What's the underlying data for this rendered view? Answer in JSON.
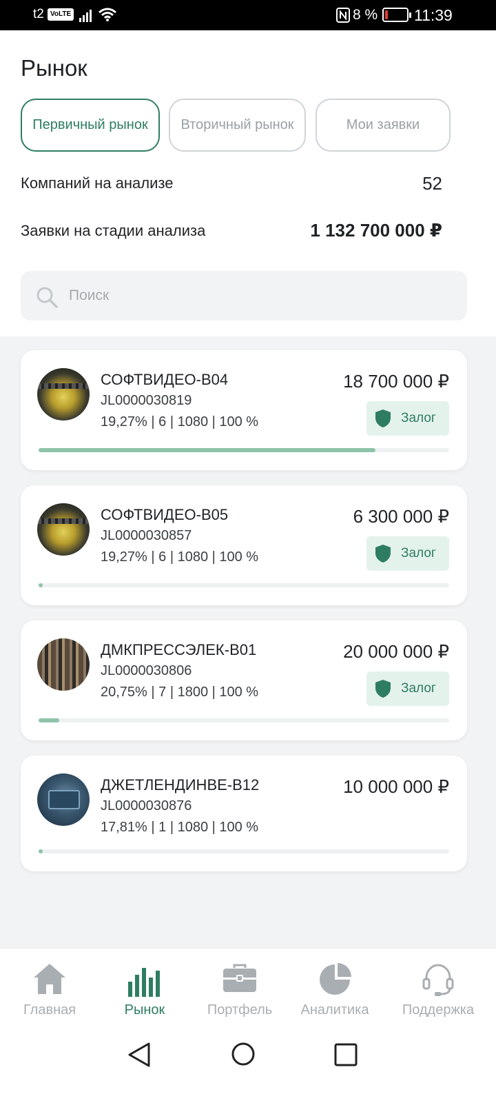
{
  "status_bar": {
    "carrier": "t2",
    "volte": "VoLTE",
    "battery_pct": "8 %",
    "time": "11:39"
  },
  "header": {
    "title": "Рынок"
  },
  "tabs": [
    {
      "label": "Первичный рынок",
      "active": true
    },
    {
      "label": "Вторичный рынок",
      "active": false
    },
    {
      "label": "Мои заявки",
      "active": false
    }
  ],
  "stats": {
    "companies_label": "Компаний на анализе",
    "companies_value": "52",
    "requests_label": "Заявки на стадии анализа",
    "requests_value": "1 132 700 000 ₽"
  },
  "search": {
    "placeholder": "Поиск",
    "value": ""
  },
  "cards": [
    {
      "name": "СОФТВИДЕО-В04",
      "code": "JL0000030819",
      "params": "19,27% | 6 | 1080 | 100 %",
      "amount": "18 700 000 ₽",
      "badge": "Залог",
      "progress": 0.82
    },
    {
      "name": "СОФТВИДЕО-В05",
      "code": "JL0000030857",
      "params": "19,27% | 6 | 1080 | 100 %",
      "amount": "6 300 000 ₽",
      "badge": "Залог",
      "progress": 0.01
    },
    {
      "name": "ДМКПРЕССЭЛЕК-В01",
      "code": "JL0000030806",
      "params": "20,75% | 7 | 1800 | 100 %",
      "amount": "20 000 000 ₽",
      "badge": "Залог",
      "progress": 0.05
    },
    {
      "name": "ДЖЕТЛЕНДИНВЕ-В12",
      "code": "JL0000030876",
      "params": "17,81% | 1 | 1080 | 100 %",
      "amount": "10 000 000 ₽",
      "badge": "",
      "progress": 0.01
    }
  ],
  "bottom_nav": [
    {
      "label": "Главная",
      "icon": "home-icon",
      "active": false
    },
    {
      "label": "Рынок",
      "icon": "bar-chart-icon",
      "active": true
    },
    {
      "label": "Портфель",
      "icon": "briefcase-icon",
      "active": false
    },
    {
      "label": "Аналитика",
      "icon": "pie-chart-icon",
      "active": false
    },
    {
      "label": "Поддержка",
      "icon": "headset-icon",
      "active": false
    }
  ],
  "colors": {
    "accent": "#2e7d62",
    "progress": "#8fc4aa",
    "badge_bg": "#e4f2ec",
    "inactive": "#a9aeb2"
  }
}
